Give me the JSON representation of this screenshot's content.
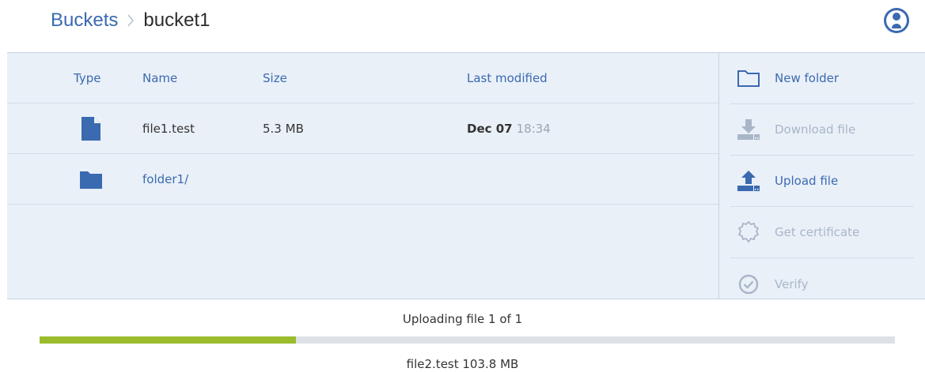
{
  "breadcrumb": {
    "root": "Buckets",
    "current": "bucket1"
  },
  "account_icon": "user-account-icon",
  "table": {
    "headers": {
      "type": "Type",
      "name": "Name",
      "size": "Size",
      "last_modified": "Last modified"
    },
    "rows": [
      {
        "type_icon": "file-icon",
        "name": "file1.test",
        "size": "5.3 MB",
        "date": "Dec 07",
        "time": "18:34"
      },
      {
        "type_icon": "folder-icon",
        "name": "folder1/",
        "size": "",
        "date": "",
        "time": ""
      }
    ]
  },
  "actions": [
    {
      "label": "New folder",
      "icon": "folder-outline-icon",
      "enabled": true
    },
    {
      "label": "Download file",
      "icon": "download-icon",
      "enabled": false
    },
    {
      "label": "Upload file",
      "icon": "upload-icon",
      "enabled": true
    },
    {
      "label": "Get certificate",
      "icon": "certificate-icon",
      "enabled": false
    },
    {
      "label": "Verify",
      "icon": "verify-icon",
      "enabled": false
    }
  ],
  "upload": {
    "status": "Uploading file 1 of 1",
    "progress_fraction": 0.3,
    "file_info": "file2.test 103.8 MB"
  },
  "colors": {
    "accent": "#3a6ab0",
    "disabled": "#a8b6c8",
    "panel_bg": "#eaf0f8",
    "progress": "#9bbc2c",
    "progress_track": "#dde2e8"
  }
}
